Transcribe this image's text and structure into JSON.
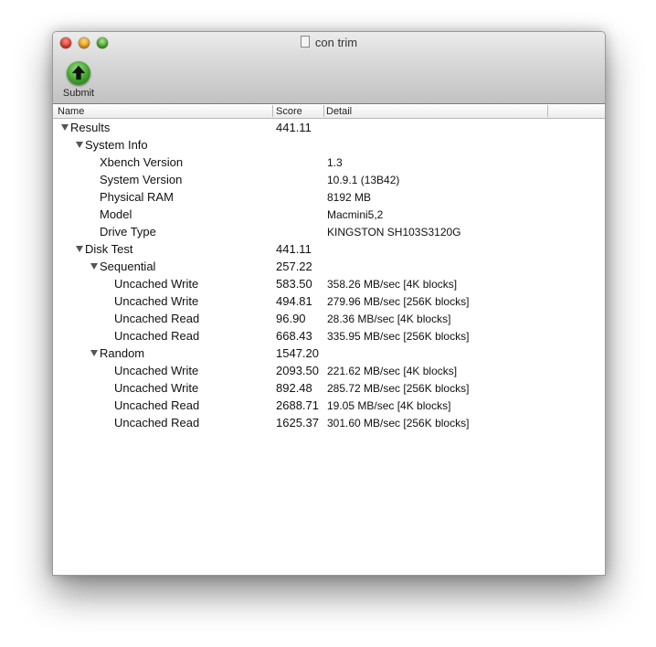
{
  "window": {
    "title": "con trim"
  },
  "toolbar": {
    "submit_label": "Submit"
  },
  "table": {
    "columns": [
      "Name",
      "Score",
      "Detail"
    ],
    "rows": [
      {
        "name": "Results",
        "score": "441.11",
        "detail": "",
        "level": 0,
        "expanded": true
      },
      {
        "name": "System Info",
        "score": "",
        "detail": "",
        "level": 1,
        "expanded": true
      },
      {
        "name": "Xbench Version",
        "score": "",
        "detail": "1.3",
        "level": 2
      },
      {
        "name": "System Version",
        "score": "",
        "detail": "10.9.1 (13B42)",
        "level": 2
      },
      {
        "name": "Physical RAM",
        "score": "",
        "detail": "8192 MB",
        "level": 2
      },
      {
        "name": "Model",
        "score": "",
        "detail": "Macmini5,2",
        "level": 2
      },
      {
        "name": "Drive Type",
        "score": "",
        "detail": "KINGSTON SH103S3120G",
        "level": 2
      },
      {
        "name": "Disk Test",
        "score": "441.11",
        "detail": "",
        "level": 1,
        "expanded": true
      },
      {
        "name": "Sequential",
        "score": "257.22",
        "detail": "",
        "level": 2,
        "expanded": true
      },
      {
        "name": "Uncached Write",
        "score": "583.50",
        "detail": "358.26 MB/sec [4K blocks]",
        "level": 3
      },
      {
        "name": "Uncached Write",
        "score": "494.81",
        "detail": "279.96 MB/sec [256K blocks]",
        "level": 3
      },
      {
        "name": "Uncached Read",
        "score": "96.90",
        "detail": "28.36 MB/sec [4K blocks]",
        "level": 3
      },
      {
        "name": "Uncached Read",
        "score": "668.43",
        "detail": "335.95 MB/sec [256K blocks]",
        "level": 3
      },
      {
        "name": "Random",
        "score": "1547.20",
        "detail": "",
        "level": 2,
        "expanded": true
      },
      {
        "name": "Uncached Write",
        "score": "2093.50",
        "detail": "221.62 MB/sec [4K blocks]",
        "level": 3
      },
      {
        "name": "Uncached Write",
        "score": "892.48",
        "detail": "285.72 MB/sec [256K blocks]",
        "level": 3
      },
      {
        "name": "Uncached Read",
        "score": "2688.71",
        "detail": "19.05 MB/sec [4K blocks]",
        "level": 3
      },
      {
        "name": "Uncached Read",
        "score": "1625.37",
        "detail": "301.60 MB/sec [256K blocks]",
        "level": 3
      }
    ]
  }
}
